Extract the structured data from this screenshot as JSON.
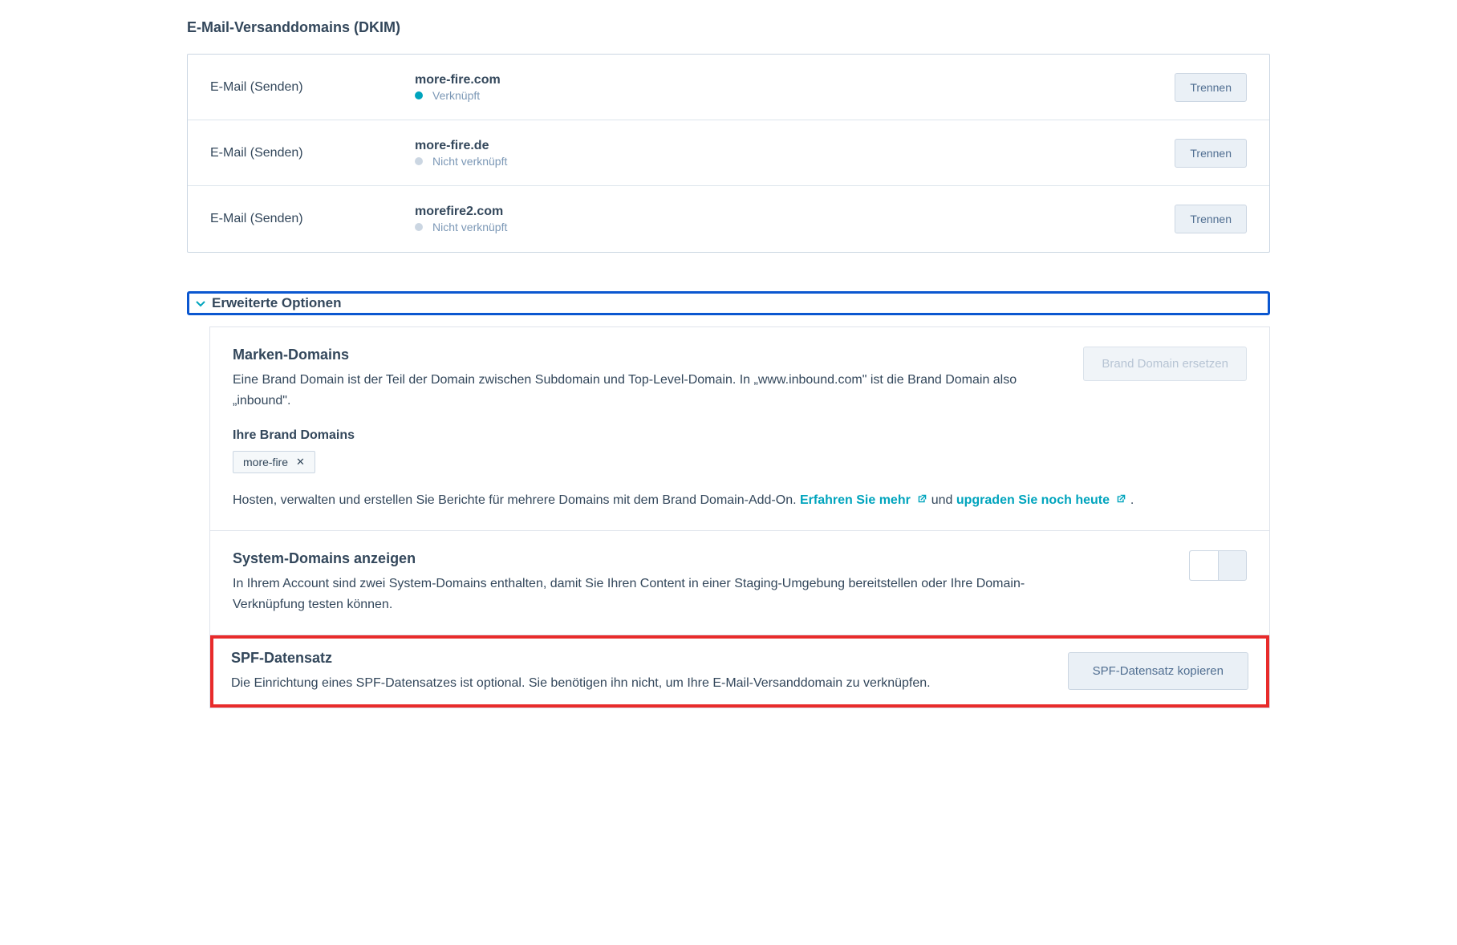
{
  "dkim": {
    "title": "E-Mail-Versanddomains (DKIM)",
    "rows": [
      {
        "type": "E-Mail (Senden)",
        "domain": "more-fire.com",
        "status": "Verknüpft",
        "connected": true,
        "action": "Trennen"
      },
      {
        "type": "E-Mail (Senden)",
        "domain": "more-fire.de",
        "status": "Nicht verknüpft",
        "connected": false,
        "action": "Trennen"
      },
      {
        "type": "E-Mail (Senden)",
        "domain": "morefire2.com",
        "status": "Nicht verknüpft",
        "connected": false,
        "action": "Trennen"
      }
    ]
  },
  "advanced": {
    "header": "Erweiterte Optionen",
    "brand": {
      "title": "Marken-Domains",
      "desc": "Eine Brand Domain ist der Teil der Domain zwischen Subdomain und Top-Level-Domain. In „www.inbound.com\" ist die Brand Domain also „inbound\".",
      "yourLabel": "Ihre Brand Domains",
      "replaceBtn": "Brand Domain ersetzen",
      "tag": "more-fire",
      "addonPre": "Hosten, verwalten und erstellen Sie Berichte für mehrere Domains mit dem Brand Domain-Add-On. ",
      "link1": "Erfahren Sie mehr",
      "mid": "  und ",
      "link2": "upgraden Sie noch heute",
      "post": " ."
    },
    "system": {
      "title": "System-Domains anzeigen",
      "desc": "In Ihrem Account sind zwei System-Domains enthalten, damit Sie Ihren Content in einer Staging-Umgebung bereitstellen oder Ihre Domain-Verknüpfung testen können."
    },
    "spf": {
      "title": "SPF-Datensatz",
      "desc": "Die Einrichtung eines SPF-Datensatzes ist optional. Sie benötigen ihn nicht, um Ihre E-Mail-Versanddomain zu verknüpfen.",
      "btn": "SPF-Datensatz kopieren"
    }
  }
}
